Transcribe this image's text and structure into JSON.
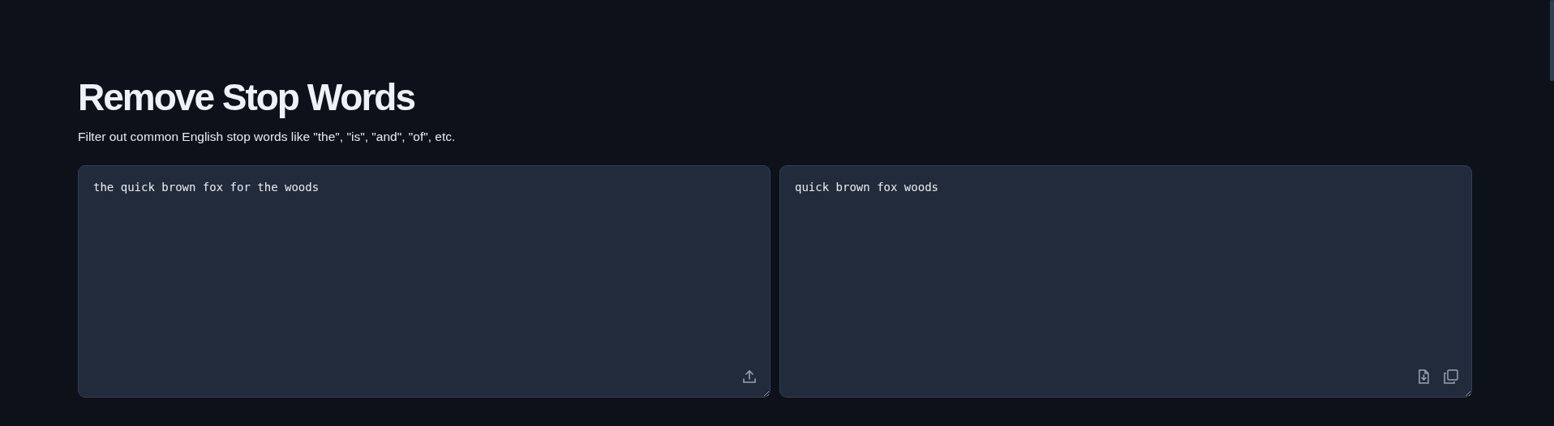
{
  "title": "Remove Stop Words",
  "description": "Filter out common English stop words like \"the\", \"is\", \"and\", \"of\", etc.",
  "input": {
    "value": "the quick brown fox for the woods"
  },
  "output": {
    "value": "quick brown fox woods"
  }
}
